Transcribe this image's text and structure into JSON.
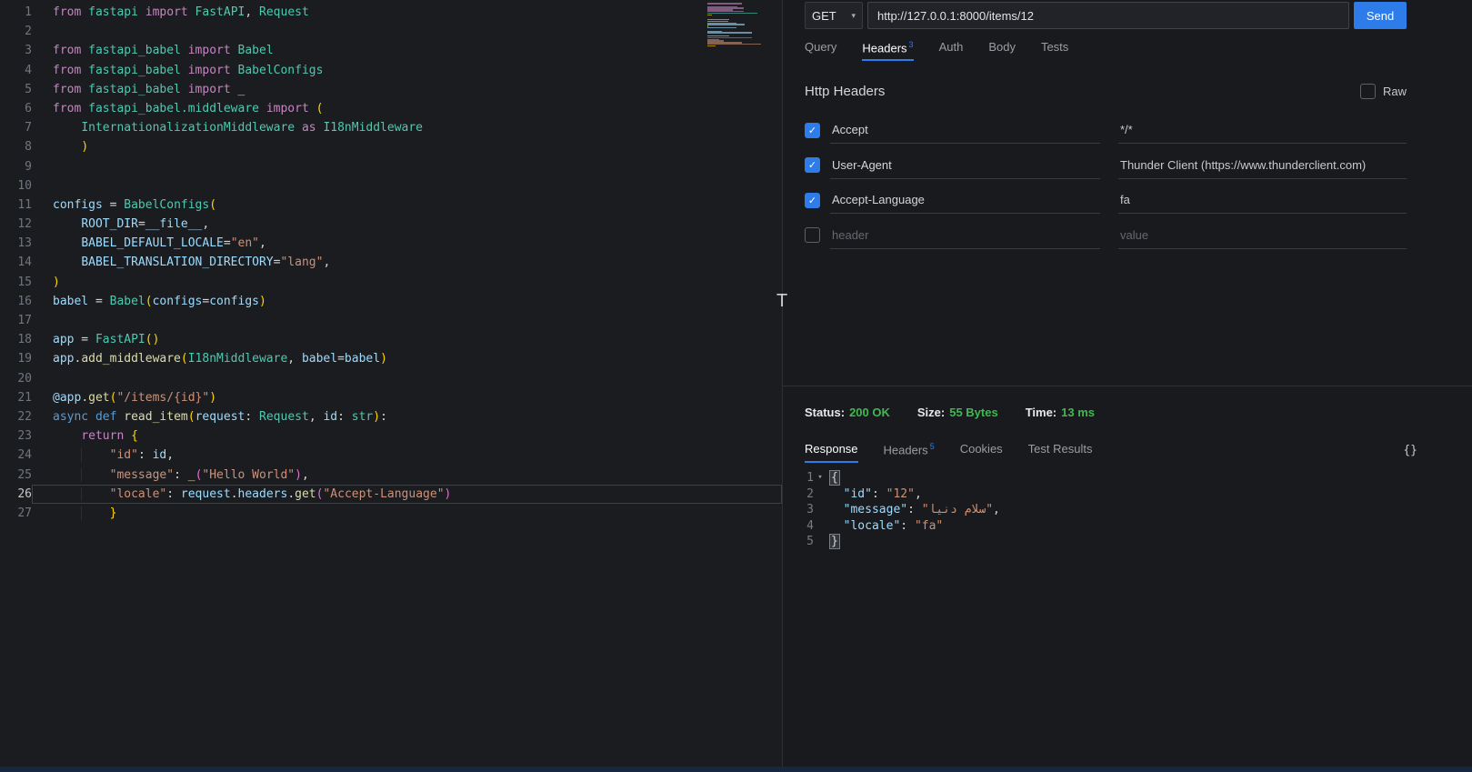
{
  "colors": {
    "accent": "#2e7cea",
    "success": "#3fb950"
  },
  "editor": {
    "overlay_glyph": "T",
    "lines": [
      {
        "n": "1",
        "tokens": [
          [
            "from",
            "kw"
          ],
          [
            " fastapi ",
            "type"
          ],
          [
            "import",
            "kw"
          ],
          [
            " FastAPI",
            "type"
          ],
          [
            ", ",
            "pl"
          ],
          [
            "Request",
            "type"
          ]
        ]
      },
      {
        "n": "2",
        "tokens": []
      },
      {
        "n": "3",
        "tokens": [
          [
            "from",
            "kw"
          ],
          [
            " fastapi_babel ",
            "type"
          ],
          [
            "import",
            "kw"
          ],
          [
            " Babel",
            "type"
          ]
        ]
      },
      {
        "n": "4",
        "tokens": [
          [
            "from",
            "kw"
          ],
          [
            " fastapi_babel ",
            "type"
          ],
          [
            "import",
            "kw"
          ],
          [
            " BabelConfigs",
            "type"
          ]
        ]
      },
      {
        "n": "5",
        "tokens": [
          [
            "from",
            "kw"
          ],
          [
            " fastapi_babel ",
            "type"
          ],
          [
            "import",
            "kw"
          ],
          [
            " _",
            "pl"
          ]
        ]
      },
      {
        "n": "6",
        "tokens": [
          [
            "from",
            "kw"
          ],
          [
            " fastapi_babel.middleware ",
            "type"
          ],
          [
            "import",
            "kw"
          ],
          [
            " ",
            "pl"
          ],
          [
            "(",
            "b1"
          ]
        ]
      },
      {
        "n": "7",
        "indent": 4,
        "tokens": [
          [
            "InternationalizationMiddleware",
            "type"
          ],
          [
            " as ",
            "kw"
          ],
          [
            "I18nMiddleware",
            "type"
          ]
        ]
      },
      {
        "n": "8",
        "indent": 4,
        "tokens": [
          [
            ")",
            "b1"
          ]
        ]
      },
      {
        "n": "9",
        "tokens": []
      },
      {
        "n": "10",
        "tokens": []
      },
      {
        "n": "11",
        "tokens": [
          [
            "configs",
            "var"
          ],
          [
            " = ",
            "pl"
          ],
          [
            "BabelConfigs",
            "type"
          ],
          [
            "(",
            "b1"
          ]
        ]
      },
      {
        "n": "12",
        "indent": 4,
        "tokens": [
          [
            "ROOT_DIR",
            "var"
          ],
          [
            "=",
            "pl"
          ],
          [
            "__file__",
            "var"
          ],
          [
            ",",
            "pl"
          ]
        ]
      },
      {
        "n": "13",
        "indent": 4,
        "tokens": [
          [
            "BABEL_DEFAULT_LOCALE",
            "var"
          ],
          [
            "=",
            "pl"
          ],
          [
            "\"en\"",
            "str"
          ],
          [
            ",",
            "pl"
          ]
        ]
      },
      {
        "n": "14",
        "indent": 4,
        "tokens": [
          [
            "BABEL_TRANSLATION_DIRECTORY",
            "var"
          ],
          [
            "=",
            "pl"
          ],
          [
            "\"lang\"",
            "str"
          ],
          [
            ",",
            "pl"
          ]
        ]
      },
      {
        "n": "15",
        "tokens": [
          [
            ")",
            "b1"
          ]
        ]
      },
      {
        "n": "16",
        "tokens": [
          [
            "babel",
            "var"
          ],
          [
            " = ",
            "pl"
          ],
          [
            "Babel",
            "type"
          ],
          [
            "(",
            "b1"
          ],
          [
            "configs",
            "var"
          ],
          [
            "=",
            "pl"
          ],
          [
            "configs",
            "var"
          ],
          [
            ")",
            "b1"
          ]
        ]
      },
      {
        "n": "17",
        "tokens": []
      },
      {
        "n": "18",
        "tokens": [
          [
            "app",
            "var"
          ],
          [
            " = ",
            "pl"
          ],
          [
            "FastAPI",
            "type"
          ],
          [
            "(",
            "b1"
          ],
          [
            ")",
            "b1"
          ]
        ]
      },
      {
        "n": "19",
        "tokens": [
          [
            "app",
            "var"
          ],
          [
            ".",
            "pl"
          ],
          [
            "add_middleware",
            "fn"
          ],
          [
            "(",
            "b1"
          ],
          [
            "I18nMiddleware",
            "type"
          ],
          [
            ", ",
            "pl"
          ],
          [
            "babel",
            "var"
          ],
          [
            "=",
            "pl"
          ],
          [
            "babel",
            "var"
          ],
          [
            ")",
            "b1"
          ]
        ]
      },
      {
        "n": "20",
        "tokens": []
      },
      {
        "n": "21",
        "tokens": [
          [
            "@app",
            "var"
          ],
          [
            ".",
            "pl"
          ],
          [
            "get",
            "fn"
          ],
          [
            "(",
            "b1"
          ],
          [
            "\"/items/{id}\"",
            "str"
          ],
          [
            ")",
            "b1"
          ]
        ]
      },
      {
        "n": "22",
        "tokens": [
          [
            "async",
            "kw2"
          ],
          [
            " ",
            "pl"
          ],
          [
            "def",
            "kw2"
          ],
          [
            " ",
            "pl"
          ],
          [
            "read_item",
            "fn"
          ],
          [
            "(",
            "b1"
          ],
          [
            "request",
            "var"
          ],
          [
            ": ",
            "pl"
          ],
          [
            "Request",
            "type"
          ],
          [
            ", ",
            "pl"
          ],
          [
            "id",
            "var"
          ],
          [
            ": ",
            "pl"
          ],
          [
            "str",
            "type"
          ],
          [
            ")",
            "b1"
          ],
          [
            ":",
            "pl"
          ]
        ]
      },
      {
        "n": "23",
        "indent": 4,
        "tokens": [
          [
            "return",
            "kw"
          ],
          [
            " ",
            "pl"
          ],
          [
            "{",
            "b1"
          ]
        ]
      },
      {
        "n": "24",
        "indent": 8,
        "tokens": [
          [
            "\"id\"",
            "str"
          ],
          [
            ": ",
            "pl"
          ],
          [
            "id",
            "var"
          ],
          [
            ",",
            "pl"
          ]
        ]
      },
      {
        "n": "25",
        "indent": 8,
        "tokens": [
          [
            "\"message\"",
            "str"
          ],
          [
            ": ",
            "pl"
          ],
          [
            "_",
            "fn"
          ],
          [
            "(",
            "b2"
          ],
          [
            "\"Hello World\"",
            "str"
          ],
          [
            ")",
            "b2"
          ],
          [
            ",",
            "pl"
          ]
        ]
      },
      {
        "n": "26",
        "indent": 8,
        "active": true,
        "tokens": [
          [
            "\"locale\"",
            "str"
          ],
          [
            ": ",
            "pl"
          ],
          [
            "request",
            "var"
          ],
          [
            ".",
            "pl"
          ],
          [
            "headers",
            "var"
          ],
          [
            ".",
            "pl"
          ],
          [
            "get",
            "fn"
          ],
          [
            "(",
            "b2"
          ],
          [
            "\"Accept-Language\"",
            "str"
          ],
          [
            ")",
            "b2"
          ]
        ]
      },
      {
        "n": "27",
        "indent": 8,
        "tokens": [
          [
            "}",
            "b1"
          ]
        ]
      }
    ]
  },
  "client": {
    "request": {
      "method": "GET",
      "url": "http://127.0.0.1:8000/items/12",
      "send_label": "Send",
      "tabs": [
        {
          "label": "Query"
        },
        {
          "label": "Headers",
          "count": "3",
          "active": true
        },
        {
          "label": "Auth"
        },
        {
          "label": "Body"
        },
        {
          "label": "Tests"
        }
      ],
      "section_title": "Http Headers",
      "raw_label": "Raw",
      "raw_checked": false,
      "headers": [
        {
          "checked": true,
          "name": "Accept",
          "value": "*/*"
        },
        {
          "checked": true,
          "name": "User-Agent",
          "value": "Thunder Client (https://www.thunderclient.com)"
        },
        {
          "checked": true,
          "name": "Accept-Language",
          "value": "fa"
        },
        {
          "checked": false,
          "name_placeholder": "header",
          "value_placeholder": "value"
        }
      ]
    },
    "response": {
      "status_label": "Status:",
      "status_value": "200 OK",
      "size_label": "Size:",
      "size_value": "55 Bytes",
      "time_label": "Time:",
      "time_value": "13 ms",
      "tabs": [
        {
          "label": "Response",
          "active": true
        },
        {
          "label": "Headers",
          "count": "5"
        },
        {
          "label": "Cookies"
        },
        {
          "label": "Test Results"
        }
      ],
      "braces_icon": "{}",
      "json_lines": [
        {
          "n": "1",
          "fold": true,
          "tokens": [
            [
              "{",
              "hl"
            ]
          ]
        },
        {
          "n": "2",
          "indent": 2,
          "tokens": [
            [
              "\"id\"",
              "key"
            ],
            [
              ": ",
              "pl"
            ],
            [
              "\"12\"",
              "str"
            ],
            [
              ",",
              "pl"
            ]
          ]
        },
        {
          "n": "3",
          "indent": 2,
          "tokens": [
            [
              "\"message\"",
              "key"
            ],
            [
              ": ",
              "pl"
            ],
            [
              "\"سلام دنیا\"",
              "str"
            ],
            [
              ",",
              "pl"
            ]
          ]
        },
        {
          "n": "4",
          "indent": 2,
          "tokens": [
            [
              "\"locale\"",
              "key"
            ],
            [
              ": ",
              "pl"
            ],
            [
              "\"fa\"",
              "str"
            ]
          ]
        },
        {
          "n": "5",
          "tokens": [
            [
              "}",
              "hl"
            ]
          ]
        }
      ]
    }
  }
}
